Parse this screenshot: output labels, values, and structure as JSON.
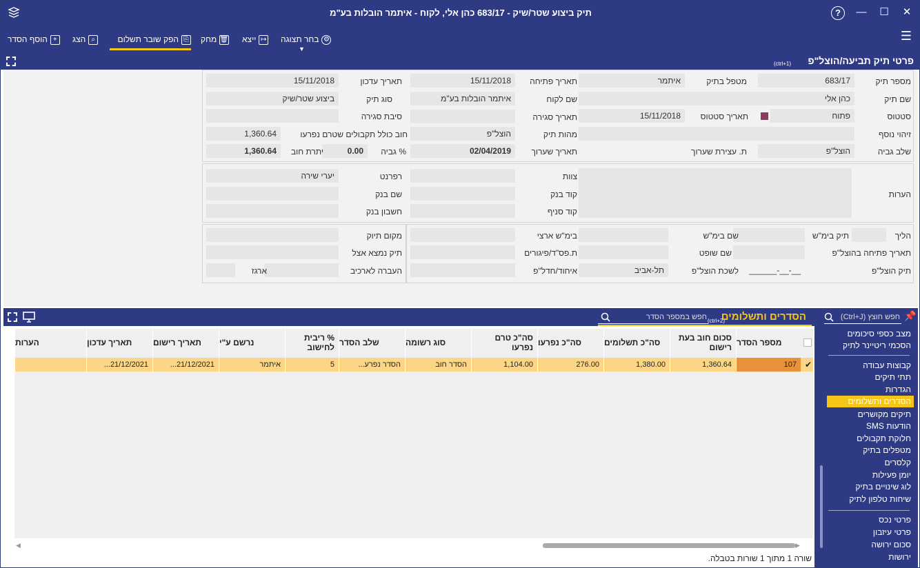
{
  "window": {
    "title": "תיק ביצוע שטר/שיק - 683/17 כהן אלי, לקוח - איתמר הובלות בע\"מ",
    "help": "?",
    "minimize": "—",
    "maximize": "☐",
    "close": "✕",
    "menu": "☰"
  },
  "toolbar": {
    "add": "הוסף הסדר",
    "show": "הצג",
    "issue": "הפק שובר תשלום",
    "delete": "מחק",
    "export": "ייצא",
    "choose_view": "בחר תצוגה"
  },
  "form": {
    "title": "פרטי תיק תביעה/הוצל\"פ",
    "shortcut": "(ctrl+1)",
    "file_number_label": "מספר תיק",
    "file_number": "683/17",
    "file_name_label": "שם תיק",
    "file_name": "כהן אלי",
    "status_label": "סטטוס",
    "status": "פתוח",
    "extra_id_label": "זיהוי נוסף",
    "collection_stage_label": "שלב גביה",
    "collection_stage": "הוצל\"פ",
    "handler_label": "מטפל בתיק",
    "handler": "איתמר",
    "status_date_label": "תאריך סטטוס",
    "status_date": "15/11/2018",
    "evaluation_stop_label": "ת. עצירת שערוך",
    "open_date_label": "תאריך פתיחה",
    "open_date": "15/11/2018",
    "client_name_label": "שם לקוח",
    "client_name": "איתמר הובלות בע\"מ",
    "close_date_label": "תאריך סגירה",
    "file_nature_label": "מהות תיק",
    "file_nature": "הוצל\"פ",
    "evaluation_date_label": "תאריך שערוך",
    "evaluation_date": "02/04/2019",
    "update_date_label": "תאריך עדכון",
    "update_date": "15/11/2018",
    "file_type_label": "סוג תיק",
    "file_type": "ביצוע שטר/שיק",
    "close_reason_label": "סיבת סגירה",
    "debt_incl_label": "חוב כולל תקבולים שטרם נפרעו",
    "debt_incl": "1,360.64",
    "collection_pct_label": "% גביה",
    "collection_pct": "0.00",
    "debt_balance_label": "יתרת חוב",
    "debt_balance": "1,360.64",
    "notes_label": "הערות",
    "team_label": "צוות",
    "bank_code_label": "קוד בנק",
    "branch_code_label": "קוד סניף",
    "referent_label": "רפרנט",
    "referent": "יערי  שירה",
    "bank_name_label": "שם בנק",
    "bank_account_label": "חשבון בנק",
    "procedure_label": "הליך",
    "court_file_label": "תיק בימ\"ש",
    "court_open_date_label": "תאריך פתיחה בהוצל\"פ",
    "enforcement_file_label": "תיק הוצל\"פ",
    "enforcement_file": "__-__-______",
    "court_name_label": "שם בימ\"ש",
    "judge_name_label": "שם שופט",
    "enforcement_office_label": "לשכת הוצל\"פ",
    "enforcement_office": "תל-אביב",
    "district_court_label": "בימ\"ש ארצי",
    "bankruptcy_label": "ת.פס\"ד/פיגורים",
    "merge_label": "איחוד/חדל\"פ",
    "filing_location_label": "מקום תיוק",
    "file_at_label": "תיק נמצא אצל",
    "archive_label": "העברה לארכיב",
    "box_label": "ארגז"
  },
  "grid": {
    "title": "הסדרים ותשלומים",
    "shortcut": "(ctrl+2)",
    "search_placeholder": "חפש במספר הסדר",
    "columns": [
      "מספר הסדר",
      "סכום חוב בעת רישום",
      "סה\"כ תשלומים",
      "סה\"כ נפרעו",
      "סה\"כ טרם נפרעו",
      "סוג רשומה",
      "שלב הסדר",
      "% ריבית לחישוב",
      "נרשם ע\"י",
      "תאריך רישום",
      "תאריך עדכון",
      "הערות"
    ],
    "rows": [
      [
        "107",
        "1,360.64",
        "1,380.00",
        "276.00",
        "1,104.00",
        "הסדר חוב",
        "הסדר נפרע...",
        "5",
        "איתמר",
        "21/12/2021...",
        "21/12/2021...",
        ""
      ]
    ],
    "check_mark": "✔",
    "status": "שורה 1 מתוך 1 שורות בטבלה."
  },
  "sidebar": {
    "search_placeholder": "חפש חוצץ (Ctrl+J)",
    "items": [
      "מצב כספי סיכומים",
      "הסכמי ריטיינר לתיק",
      "קבוצות עבודה",
      "תתי תיקים",
      "הגדרות",
      "הסדרים ותשלומים",
      "תיקים מקושרים",
      "הודעות SMS",
      "חלוקת תקבולים",
      "מטפלים בתיק",
      "קלסרים",
      "יומן פעילות",
      "לוג שינויים בתיק",
      "שיחות טלפון לתיק",
      "פרטי נכס",
      "פרטי עיזבון",
      "סכום ירושה",
      "ירושות"
    ]
  },
  "colors": {
    "header": "#2f3a84",
    "accent": "#f5c518",
    "selected_row": "#fbd687",
    "selected_cell": "#e8903a",
    "status_square": "#8b3a62"
  }
}
